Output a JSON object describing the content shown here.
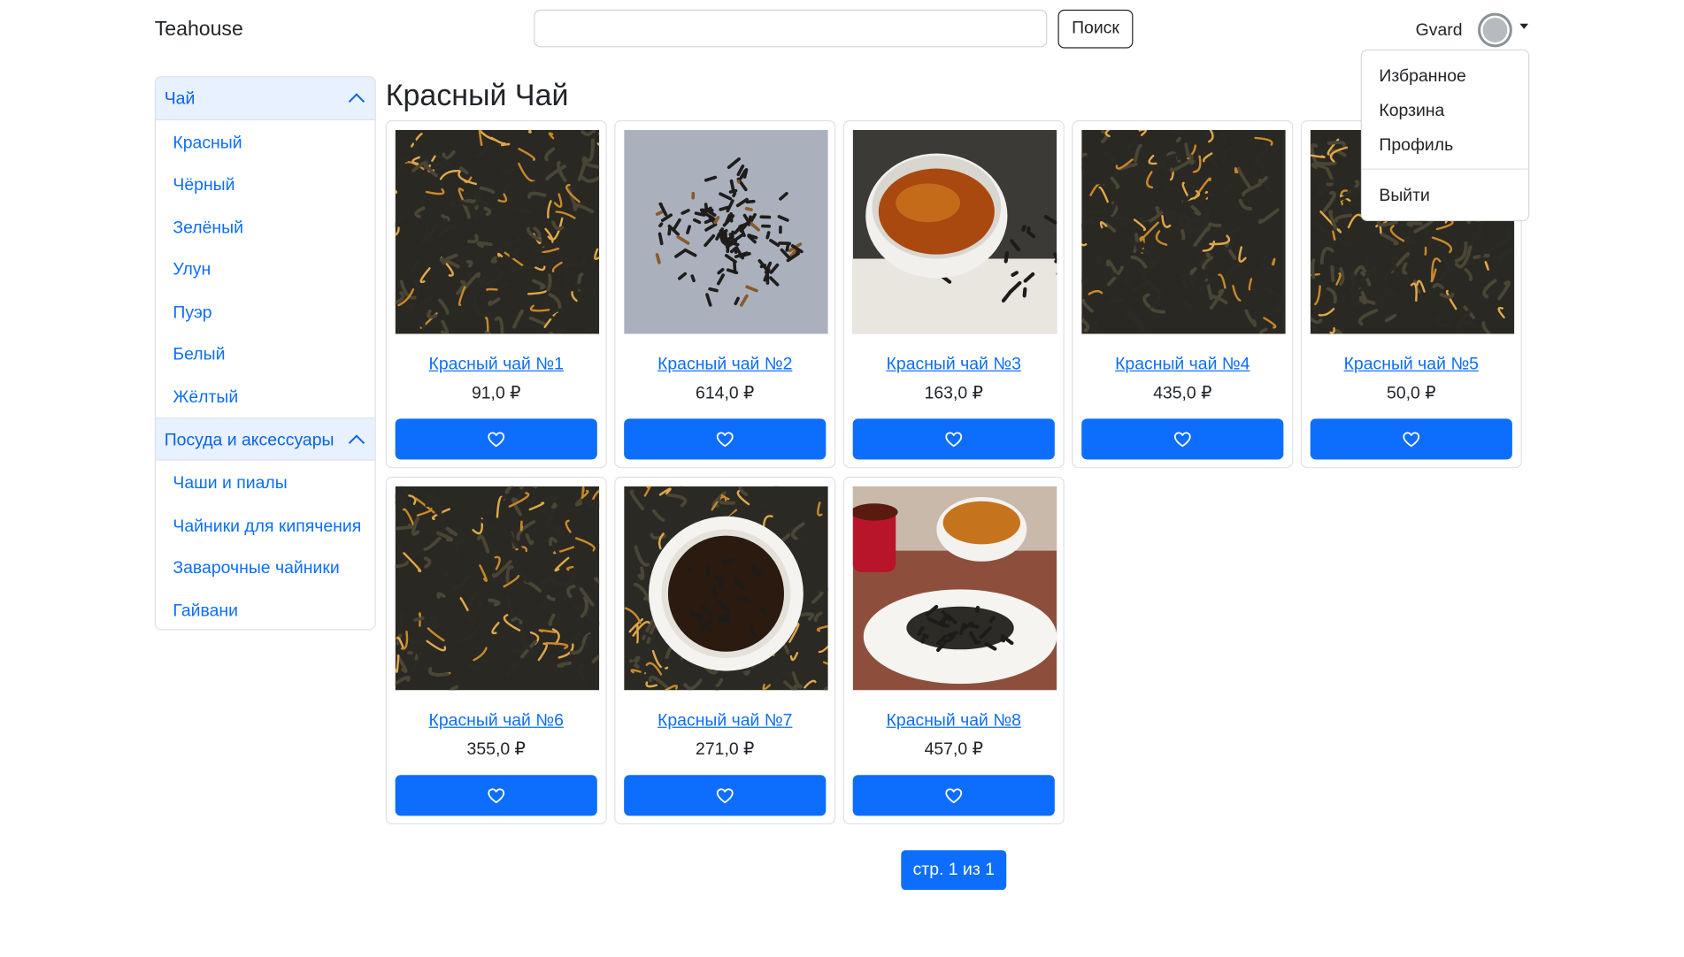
{
  "navbar": {
    "brand": "Teahouse",
    "search_placeholder": "",
    "search_value": "",
    "search_button": "Поиск",
    "username": "Gvard"
  },
  "user_menu": {
    "items": [
      "Избранное",
      "Корзина",
      "Профиль"
    ],
    "logout": "Выйти"
  },
  "sidebar": {
    "sections": [
      {
        "title": "Чай",
        "links": [
          "Красный",
          "Чёрный",
          "Зелёный",
          "Улун",
          "Пуэр",
          "Белый",
          "Жёлтый"
        ]
      },
      {
        "title": "Посуда и аксессуары",
        "links": [
          "Чаши и пиалы",
          "Чайники для кипячения",
          "Заварочные чайники",
          "Гайвани"
        ]
      }
    ]
  },
  "main": {
    "title": "Красный Чай",
    "products": [
      {
        "name": "Красный чай №1",
        "price": "91,0 ₽",
        "image": "loose-leaf-tea-image"
      },
      {
        "name": "Красный чай №2",
        "price": "614,0 ₽",
        "image": "tea-pile-image"
      },
      {
        "name": "Красный чай №3",
        "price": "163,0 ₽",
        "image": "tea-bowl-image"
      },
      {
        "name": "Красный чай №4",
        "price": "435,0 ₽",
        "image": "loose-leaf-tea-image"
      },
      {
        "name": "Красный чай №5",
        "price": "50,0 ₽",
        "image": "loose-leaf-tea-image"
      },
      {
        "name": "Красный чай №6",
        "price": "355,0 ₽",
        "image": "loose-leaf-tea-image"
      },
      {
        "name": "Красный чай №7",
        "price": "271,0 ₽",
        "image": "tea-cup-image"
      },
      {
        "name": "Красный чай №8",
        "price": "457,0 ₽",
        "image": "tea-cups-plate-image"
      }
    ],
    "favorite_icon": "heart-icon",
    "pagination": "стр. 1 из 1"
  },
  "colors": {
    "accent": "#0d6efd",
    "accordion_active_bg": "#e7f1ff",
    "accordion_active_text": "#0c63e4",
    "text": "#212529",
    "border": "#dee2e6"
  }
}
